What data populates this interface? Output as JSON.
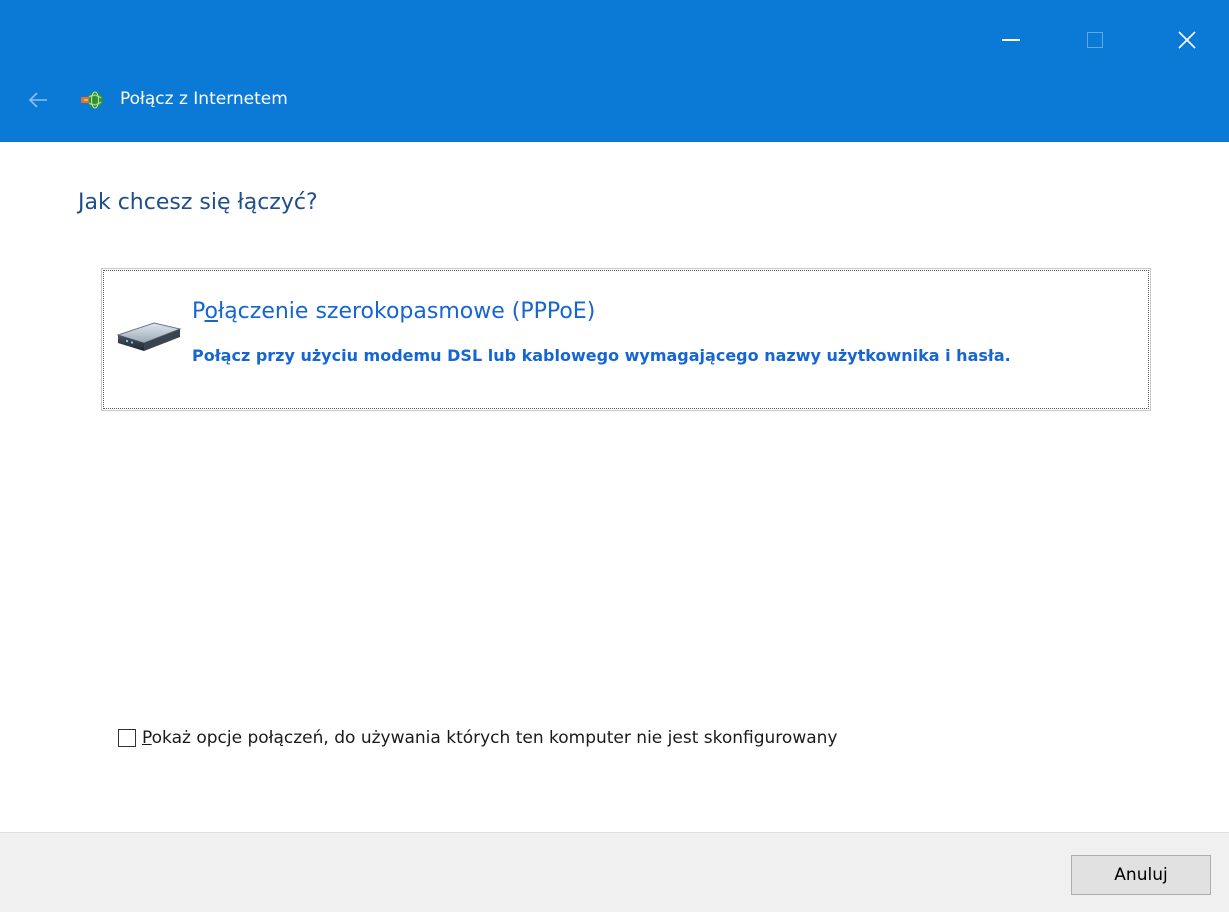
{
  "window": {
    "title": "Połącz z Internetem",
    "controls": {
      "minimize_icon": "minimize-icon",
      "maximize_icon": "maximize-icon",
      "close_icon": "close-icon"
    },
    "back_icon": "arrow-left-icon",
    "app_icon": "network-globe-icon",
    "accent_color": "#0a7ad6"
  },
  "main": {
    "heading": "Jak chcesz się łączyć?",
    "options": [
      {
        "icon": "broadband-modem-icon",
        "title_prefix": "P",
        "title_mnemonic": "o",
        "title_rest": "łączenie szerokopasmowe (PPPoE)",
        "description": "Połącz przy użyciu modemu DSL lub kablowego wymagającego nazwy użytkownika i hasła."
      }
    ],
    "show_options": {
      "checked": false,
      "label_mnemonic": "P",
      "label_rest": "okaż opcje połączeń, do używania których ten komputer nie jest skonfigurowany"
    }
  },
  "footer": {
    "cancel_label": "Anuluj"
  },
  "colors": {
    "heading": "#1f4e8c",
    "link": "#1565d2",
    "footer_bg": "#f0f0f0"
  }
}
